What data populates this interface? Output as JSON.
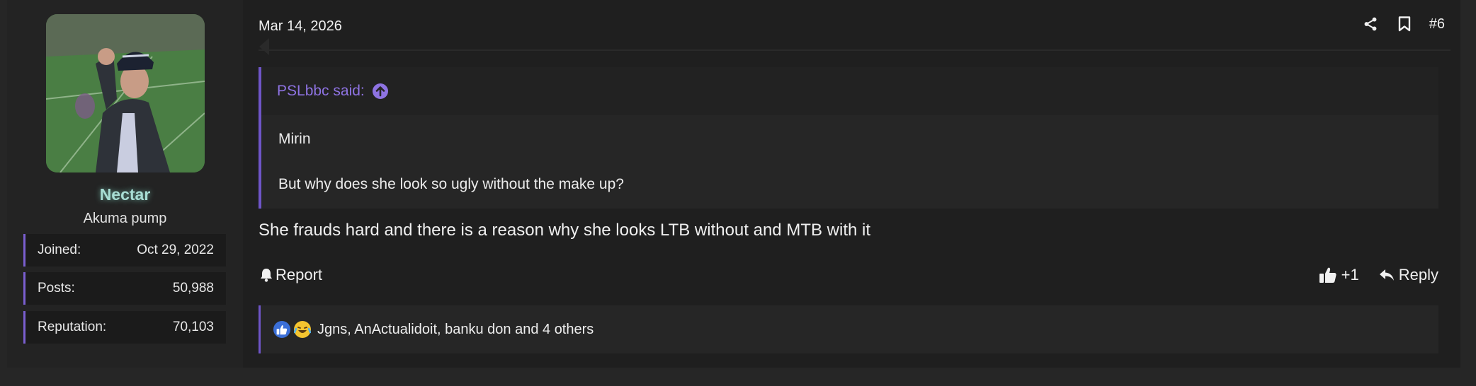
{
  "user": {
    "name": "Nectar",
    "title": "Akuma pump",
    "stats": [
      {
        "label": "Joined:",
        "value": "Oct 29, 2022"
      },
      {
        "label": "Posts:",
        "value": "50,988"
      },
      {
        "label": "Reputation:",
        "value": "70,103"
      }
    ]
  },
  "post": {
    "date": "Mar 14, 2026",
    "number": "#6",
    "quote": {
      "author": "PSLbbc said:",
      "lines": [
        "Mirin",
        "But why does she look so ugly without the make up?"
      ]
    },
    "body": "She frauds hard and there is a reason why she looks LTB without and MTB with it",
    "actions": {
      "report": "Report",
      "like_count": "+1",
      "reply": "Reply"
    },
    "reactions": {
      "icons": [
        "like-reaction-icon",
        "laugh-cry-reaction-icon"
      ],
      "text": "Jgns, AnActualidoit, banku don and 4 others"
    }
  },
  "colors": {
    "accent": "#6f55c8",
    "username_glow": "#a8ddd4",
    "quote_author": "#8e73e2"
  }
}
